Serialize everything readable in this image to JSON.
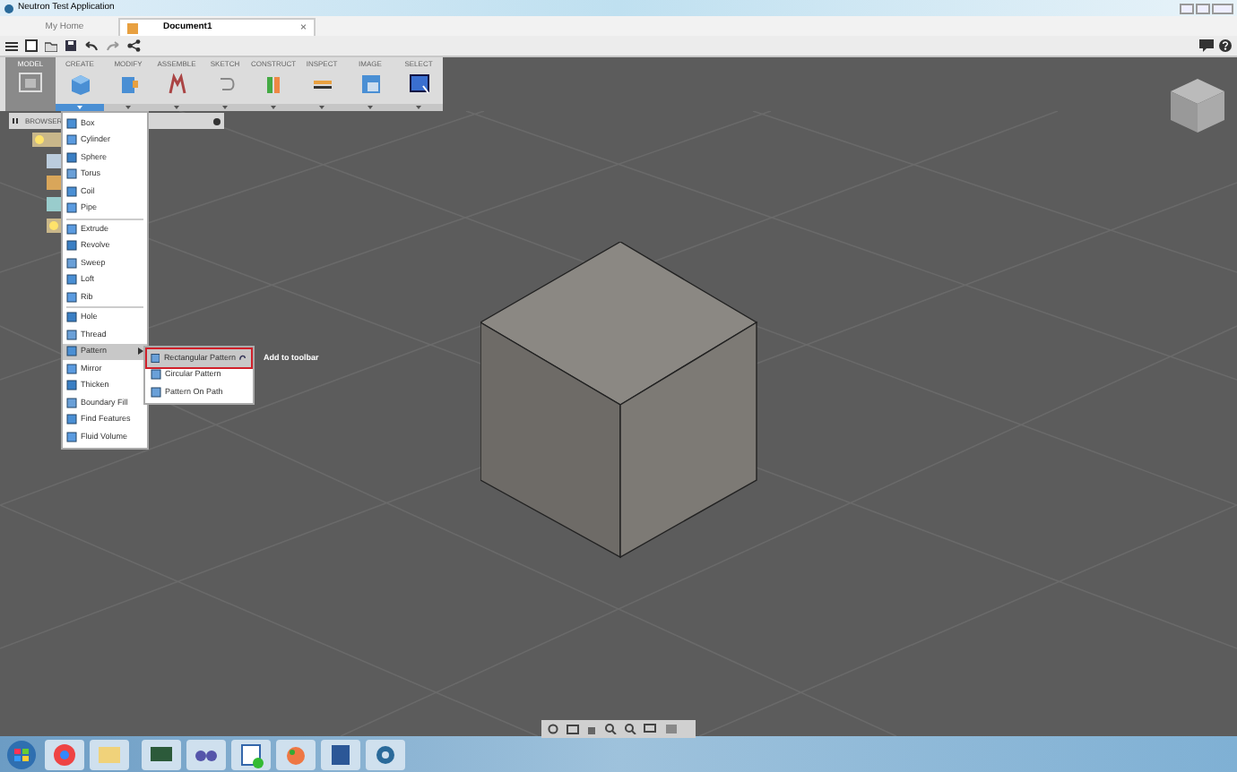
{
  "window": {
    "title": "Neutron Test Application"
  },
  "tabs": [
    {
      "label": "My Home",
      "selected": false
    },
    {
      "label": "Document1",
      "selected": true,
      "close": "×"
    }
  ],
  "ribbon": {
    "workspace": {
      "label": "MODEL",
      "selected": true
    },
    "groups": [
      {
        "label": "CREATE",
        "open": true
      },
      {
        "label": "MODIFY",
        "open": false
      },
      {
        "label": "ASSEMBLE",
        "open": false
      },
      {
        "label": "SKETCH",
        "open": false
      },
      {
        "label": "CONSTRUCT",
        "open": false
      },
      {
        "label": "INSPECT",
        "open": false
      },
      {
        "label": "IMAGE",
        "open": false
      },
      {
        "label": "SELECT",
        "open": false
      }
    ]
  },
  "browser": {
    "title": "BROWSER"
  },
  "create_menu": {
    "sections": [
      [
        {
          "label": "Box",
          "selected": false
        },
        {
          "label": "Cylinder",
          "selected": false
        },
        {
          "label": "Sphere",
          "selected": false
        },
        {
          "label": "Torus",
          "selected": false
        },
        {
          "label": "Coil",
          "selected": false
        },
        {
          "label": "Pipe",
          "selected": false
        }
      ],
      [
        {
          "label": "Extrude",
          "selected": false
        },
        {
          "label": "Revolve",
          "selected": false
        },
        {
          "label": "Sweep",
          "selected": false
        },
        {
          "label": "Loft",
          "selected": false
        },
        {
          "label": "Rib",
          "selected": false
        }
      ],
      [
        {
          "label": "Hole",
          "selected": false
        },
        {
          "label": "Thread",
          "selected": false
        },
        {
          "label": "Pattern",
          "selected": true,
          "submenu": true
        },
        {
          "label": "Mirror",
          "selected": false
        },
        {
          "label": "Thicken",
          "selected": false
        },
        {
          "label": "Boundary Fill",
          "selected": false
        },
        {
          "label": "Find Features",
          "selected": false
        },
        {
          "label": "Fluid Volume",
          "selected": false
        }
      ]
    ]
  },
  "pattern_submenu": {
    "items": [
      {
        "label": "Rectangular Pattern",
        "selected": true
      },
      {
        "label": "Circular Pattern",
        "selected": false
      },
      {
        "label": "Pattern On Path",
        "selected": false
      }
    ],
    "tooltip": "Add to toolbar"
  }
}
